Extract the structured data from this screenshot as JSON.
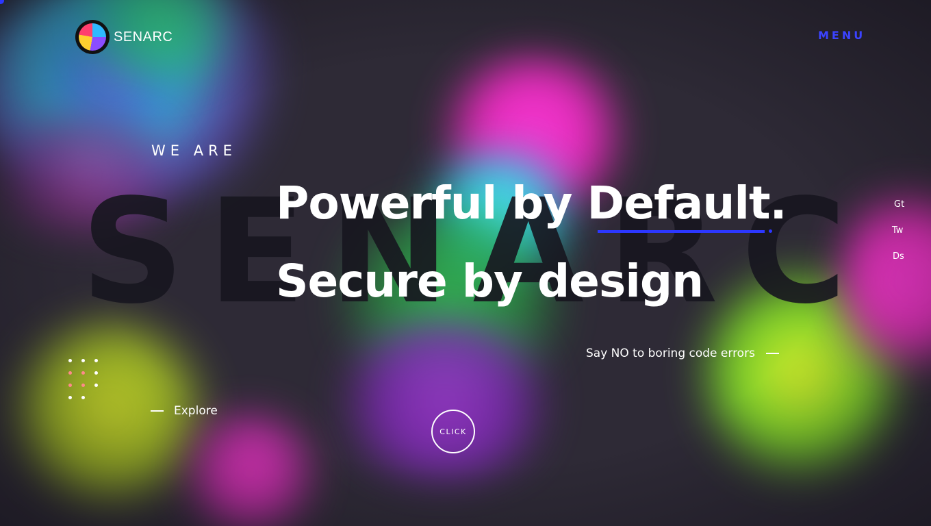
{
  "header": {
    "brand": "SENARC",
    "menu_label": "MENU"
  },
  "hero": {
    "background_word": "SENARC",
    "eyebrow": "WE ARE",
    "line1": "Powerful by Default.",
    "line2": "Secure by design",
    "tagline": "Say NO to boring code errors",
    "explore_label": "Explore",
    "click_label": "CLICK"
  },
  "social": [
    "Gt",
    "Tw",
    "Ds"
  ],
  "colors": {
    "accent": "#2c37ff",
    "menu": "#3b43ff",
    "background": "#2e2a36"
  }
}
